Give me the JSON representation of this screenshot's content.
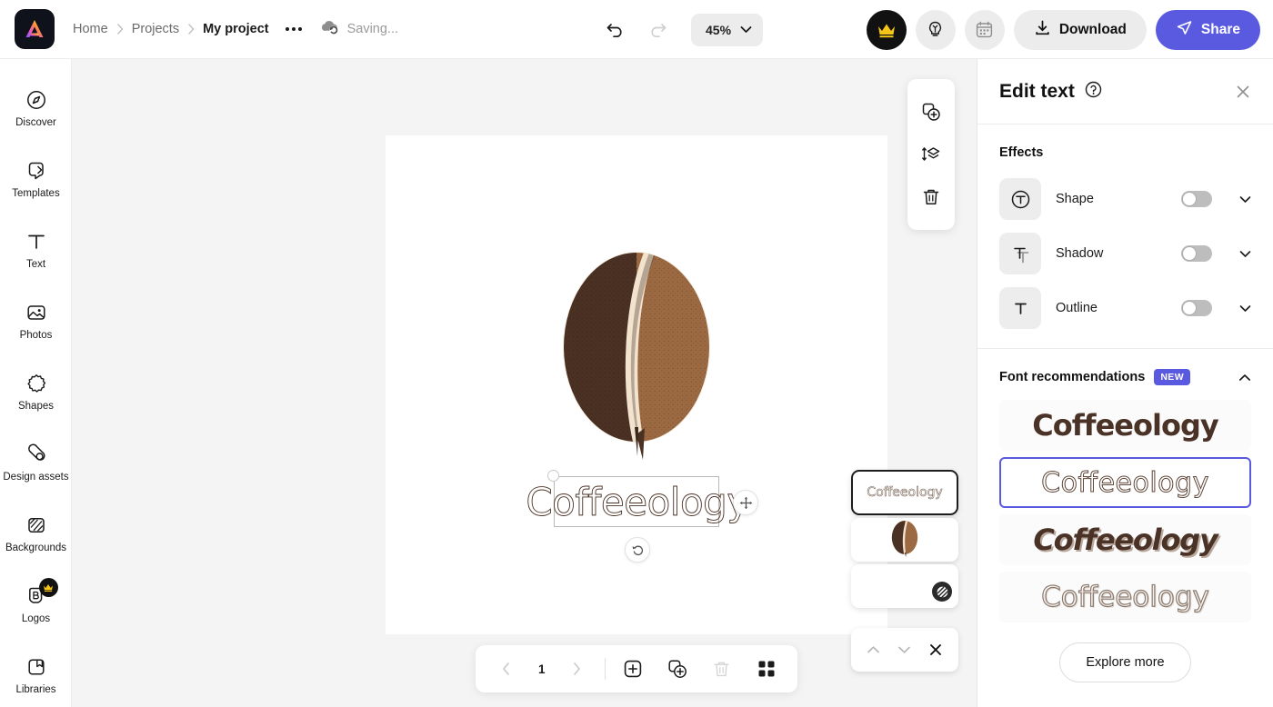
{
  "app": {
    "logo_icon": "app-logo-icon"
  },
  "header": {
    "breadcrumb": [
      {
        "label": "Home",
        "active": false
      },
      {
        "label": "Projects",
        "active": false
      },
      {
        "label": "My project",
        "active": true
      }
    ],
    "more_icon": "more-options-icon",
    "cloud_icon": "cloud-sync-icon",
    "saving_status": "Saving...",
    "undo_icon": "undo-icon",
    "redo_icon": "redo-icon",
    "zoom_value": "45%",
    "zoom_chevron_icon": "chevron-down-icon",
    "premium_icon": "crown-icon",
    "ideas_icon": "lightbulb-icon",
    "calendar_icon": "calendar-icon",
    "download_label": "Download",
    "download_icon": "download-icon",
    "share_label": "Share",
    "share_icon": "send-icon"
  },
  "sidebar": {
    "items": [
      {
        "label": "Discover",
        "icon": "compass-icon",
        "pro": false
      },
      {
        "label": "Templates",
        "icon": "templates-icon",
        "pro": false
      },
      {
        "label": "Text",
        "icon": "text-icon",
        "pro": false
      },
      {
        "label": "Photos",
        "icon": "photo-icon",
        "pro": false
      },
      {
        "label": "Shapes",
        "icon": "shapes-icon",
        "pro": false
      },
      {
        "label": "Design assets",
        "icon": "design-assets-icon",
        "pro": false
      },
      {
        "label": "Backgrounds",
        "icon": "backgrounds-icon",
        "pro": false
      },
      {
        "label": "Logos",
        "icon": "logos-icon",
        "pro": true
      },
      {
        "label": "Libraries",
        "icon": "libraries-icon",
        "pro": false
      }
    ]
  },
  "canvas": {
    "selected_text": "Coffeeology",
    "bean_dark_color": "#4b3123",
    "bean_light_color": "#9c6a42",
    "bean_crease_color": "#f2e3cf",
    "move_handle_icon": "move-icon",
    "rotate_handle_icon": "rotate-icon",
    "resize_handle_icon": "resize-handle-icon"
  },
  "object_toolbar": {
    "tools": [
      {
        "icon": "duplicate-add-icon",
        "name": "add-to-library"
      },
      {
        "icon": "layer-order-icon",
        "name": "arrange-layer"
      },
      {
        "icon": "trash-icon",
        "name": "delete-object"
      }
    ]
  },
  "layers_overlay": {
    "cards": [
      {
        "type": "text",
        "label": "Coffeeology",
        "selected": true
      },
      {
        "type": "image",
        "label": "",
        "selected": false
      },
      {
        "type": "background",
        "label": "",
        "selected": false,
        "swatch_icon": "pattern-icon"
      }
    ],
    "nav": {
      "up_icon": "chevron-up-icon",
      "down_icon": "chevron-down-icon",
      "close_icon": "close-icon"
    }
  },
  "page_toolbar": {
    "prev_icon": "chevron-left-icon",
    "page_number": "1",
    "next_icon": "chevron-right-icon",
    "add_page_icon": "add-page-icon",
    "duplicate_page_icon": "duplicate-page-icon",
    "delete_page_icon": "trash-icon",
    "grid_view_icon": "grid-view-icon"
  },
  "panel": {
    "title": "Edit text",
    "help_icon": "help-icon",
    "close_icon": "close-icon",
    "effects": {
      "title": "Effects",
      "rows": [
        {
          "label": "Shape",
          "icon": "text-shape-icon",
          "enabled": false
        },
        {
          "label": "Shadow",
          "icon": "text-shadow-icon",
          "enabled": false
        },
        {
          "label": "Outline",
          "icon": "text-outline-icon",
          "enabled": false
        }
      ]
    },
    "fonts": {
      "title": "Font recommendations",
      "badge": "NEW",
      "collapse_icon": "chevron-up-icon",
      "samples": [
        {
          "text": "Coffeeology",
          "style": "fs-1",
          "selected": false
        },
        {
          "text": "Coffeeology",
          "style": "fs-2",
          "selected": true
        },
        {
          "text": "Coffeeology",
          "style": "fs-3",
          "selected": false
        },
        {
          "text": "Coffeeology",
          "style": "fs-4",
          "selected": false
        }
      ],
      "explore_label": "Explore more"
    }
  },
  "colors": {
    "accent": "#5a5ae0",
    "workspace_bg": "#f4f4f4",
    "crown_yellow": "#f5c518"
  }
}
